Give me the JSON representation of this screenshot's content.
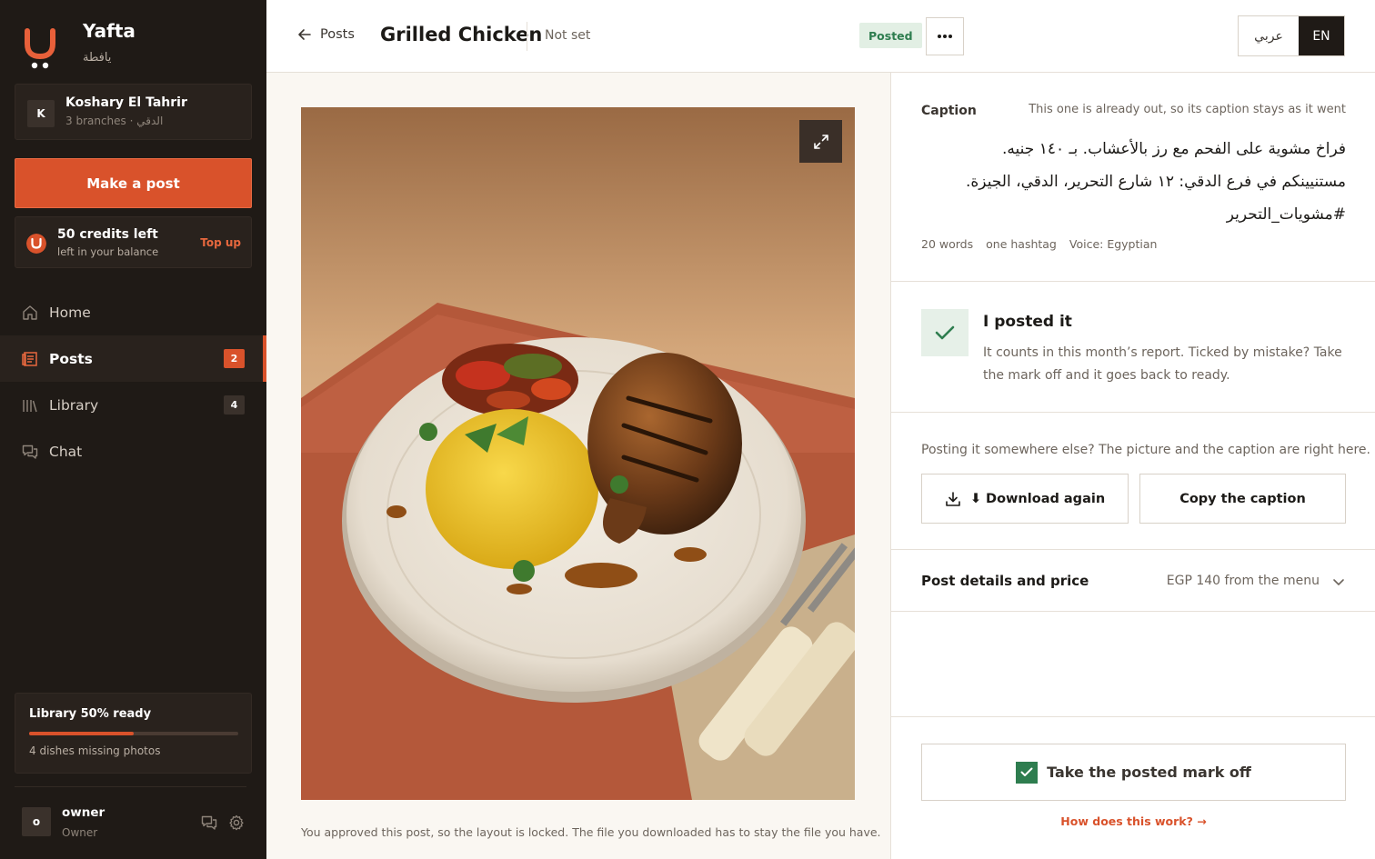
{
  "brand": {
    "name": "Yafta",
    "name_ar": "يافطة"
  },
  "branch": {
    "initial": "K",
    "name": "Koshary El Tahrir",
    "meta": "3 branches · الدقي"
  },
  "sidebar": {
    "make_post_label": "Make a post",
    "credits": {
      "title": "50 credits left",
      "subtitle": "left in your balance",
      "topup_label": "Top up"
    },
    "nav": [
      {
        "label": "Home",
        "icon": "home-icon"
      },
      {
        "label": "Posts",
        "icon": "posts-icon",
        "badge": "2",
        "active": true
      },
      {
        "label": "Library",
        "icon": "library-icon",
        "badge": "4"
      },
      {
        "label": "Chat",
        "icon": "chat-icon"
      }
    ],
    "library_status": {
      "title": "Library 50% ready",
      "progress": 0.5,
      "subtitle": "4 dishes missing photos"
    },
    "user": {
      "initial": "o",
      "name": "owner",
      "role": "Owner"
    }
  },
  "header": {
    "back_label": "Posts",
    "title": "Grilled Chicken",
    "schedule": "Not set",
    "status_badge": "Posted",
    "lang_ar": "عربي",
    "lang_en": "EN"
  },
  "image_panel": {
    "locked_note": "You approved this post, so the layout is locked. The file you downloaded has to stay the file you have."
  },
  "caption": {
    "label": "Caption",
    "hint": "This one is already out, so its caption stays as it went",
    "lines": [
      "فراخ مشوية على الفحم مع رز بالأعشاب. بـ ١٤٠ جنيه.",
      "مستنيينكم في فرع الدقي: ١٢ شارع التحرير، الدقي، الجيزة.",
      "#مشويات_التحرير"
    ],
    "words": "20 words",
    "hashtags": "one hashtag",
    "voice": "Voice: Egyptian"
  },
  "posted": {
    "title": "I posted it",
    "description": "It counts in this month’s report. Ticked by mistake? Take the mark off and it goes back to ready."
  },
  "share": {
    "hint": "Posting it somewhere else? The picture and the caption are right here.",
    "download_label": "⬇ Download again",
    "copy_label": "Copy the caption"
  },
  "details": {
    "title": "Post details and price",
    "price": "EGP 140 from the menu"
  },
  "footer": {
    "unpost_label": "Take the posted mark off",
    "how_label": "How does this work? →"
  },
  "colors": {
    "accent": "#d9522b",
    "sidebar_bg": "#1f1a16",
    "success": "#2e7d4f"
  }
}
